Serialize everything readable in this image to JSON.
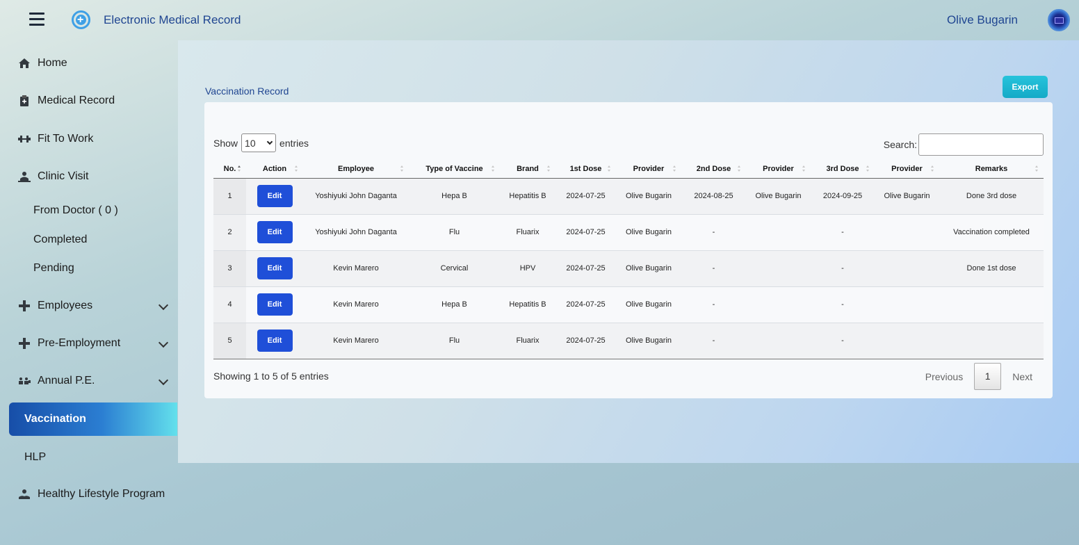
{
  "header": {
    "app_title": "Electronic Medical Record",
    "user_name": "Olive Bugarin"
  },
  "sidebar": {
    "items": [
      {
        "label": "Home",
        "icon": "home-icon"
      },
      {
        "label": "Medical Record",
        "icon": "medical-record-icon"
      },
      {
        "label": "Fit To Work",
        "icon": "fit-to-work-icon"
      },
      {
        "label": "Clinic Visit",
        "icon": "clinic-visit-icon"
      },
      {
        "label": "Employees",
        "icon": "plus-icon"
      },
      {
        "label": "Pre-Employment",
        "icon": "plus-icon"
      },
      {
        "label": "Annual P.E.",
        "icon": "annual-pe-icon"
      },
      {
        "label": "Healthy Lifestyle Program",
        "icon": "healthy-lifestyle-icon"
      }
    ],
    "clinic_sub": [
      "From Doctor ( 0 )",
      "Completed",
      "Pending"
    ],
    "active": "Vaccination",
    "hlp": "HLP"
  },
  "main": {
    "section_title": "Vaccination Record",
    "export_label": "Export",
    "show_label": "Show",
    "entries_value": "10",
    "entries_label": "entries",
    "search_label": "Search:",
    "columns": [
      "No.",
      "Action",
      "Employee",
      "Type of Vaccine",
      "Brand",
      "1st Dose",
      "Provider",
      "2nd Dose",
      "Provider",
      "3rd Dose",
      "Provider",
      "Remarks"
    ],
    "rows": [
      {
        "no": "1",
        "action": "Edit",
        "employee": "Yoshiyuki John Daganta",
        "type": "Hepa B",
        "brand": "Hepatitis B",
        "dose1": "2024-07-25",
        "prov1": "Olive Bugarin",
        "dose2": "2024-08-25",
        "prov2": "Olive Bugarin",
        "dose3": "2024-09-25",
        "prov3": "Olive Bugarin",
        "remarks": "Done 3rd dose"
      },
      {
        "no": "2",
        "action": "Edit",
        "employee": "Yoshiyuki John Daganta",
        "type": "Flu",
        "brand": "Fluarix",
        "dose1": "2024-07-25",
        "prov1": "Olive Bugarin",
        "dose2": "-",
        "prov2": "",
        "dose3": "-",
        "prov3": "",
        "remarks": "Vaccination completed"
      },
      {
        "no": "3",
        "action": "Edit",
        "employee": "Kevin Marero",
        "type": "Cervical",
        "brand": "HPV",
        "dose1": "2024-07-25",
        "prov1": "Olive Bugarin",
        "dose2": "-",
        "prov2": "",
        "dose3": "-",
        "prov3": "",
        "remarks": "Done 1st dose"
      },
      {
        "no": "4",
        "action": "Edit",
        "employee": "Kevin Marero",
        "type": "Hepa B",
        "brand": "Hepatitis B",
        "dose1": "2024-07-25",
        "prov1": "Olive Bugarin",
        "dose2": "-",
        "prov2": "",
        "dose3": "-",
        "prov3": "",
        "remarks": ""
      },
      {
        "no": "5",
        "action": "Edit",
        "employee": "Kevin Marero",
        "type": "Flu",
        "brand": "Fluarix",
        "dose1": "2024-07-25",
        "prov1": "Olive Bugarin",
        "dose2": "-",
        "prov2": "",
        "dose3": "-",
        "prov3": "",
        "remarks": ""
      }
    ],
    "info": "Showing 1 to 5 of 5 entries",
    "pager": {
      "previous": "Previous",
      "page": "1",
      "next": "Next"
    }
  },
  "colors": {
    "accent": "#1f4fd8",
    "title": "#1f4591",
    "export": "#1bb5d0"
  }
}
